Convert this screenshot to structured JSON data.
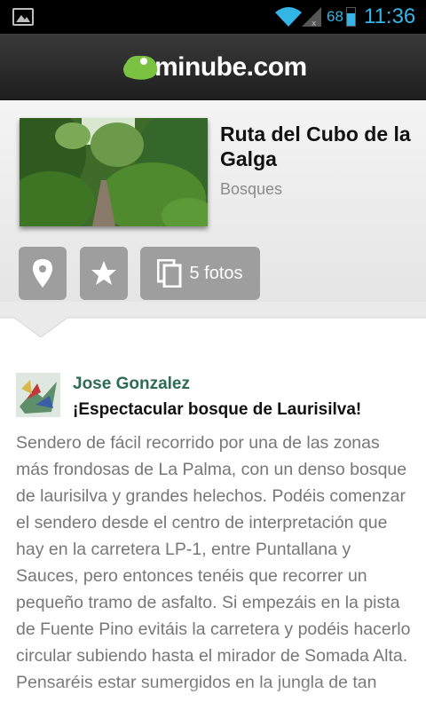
{
  "status_bar": {
    "battery_percent": "68",
    "battery_level": 0.68,
    "time": "11:36",
    "icons": [
      "picture-notification-icon",
      "wifi-icon",
      "signal-icon",
      "battery-icon"
    ],
    "accent_color": "#33b5e5"
  },
  "app_bar": {
    "logo_text": "minube.com",
    "logo_color": "#7cc242"
  },
  "place": {
    "title": "Ruta del Cubo de la Galga",
    "category": "Bosques",
    "actions": {
      "location_icon": "map-pin-icon",
      "favorite_icon": "star-icon",
      "photos_icon": "photos-icon",
      "photos_label": "5 fotos"
    }
  },
  "review": {
    "author": "Jose Gonzalez",
    "title": "¡Espectacular bosque de Laurisilva!",
    "body": "Sendero de fácil recorrido por una de las zonas más frondosas de La Palma, con un denso bosque de laurisilva y grandes helechos. Podéis comenzar el sendero desde el centro de interpretación que hay en la carretera LP-1, entre Puntallana y Sauces, pero entonces tenéis que recorrer un pequeño tramo de asfalto. Si empezáis en la pista de Fuente Pino evitáis la carretera y podéis hacerlo circular subiendo hasta el mirador de Somada Alta. Pensaréis estar sumergidos en la jungla de tan"
  }
}
